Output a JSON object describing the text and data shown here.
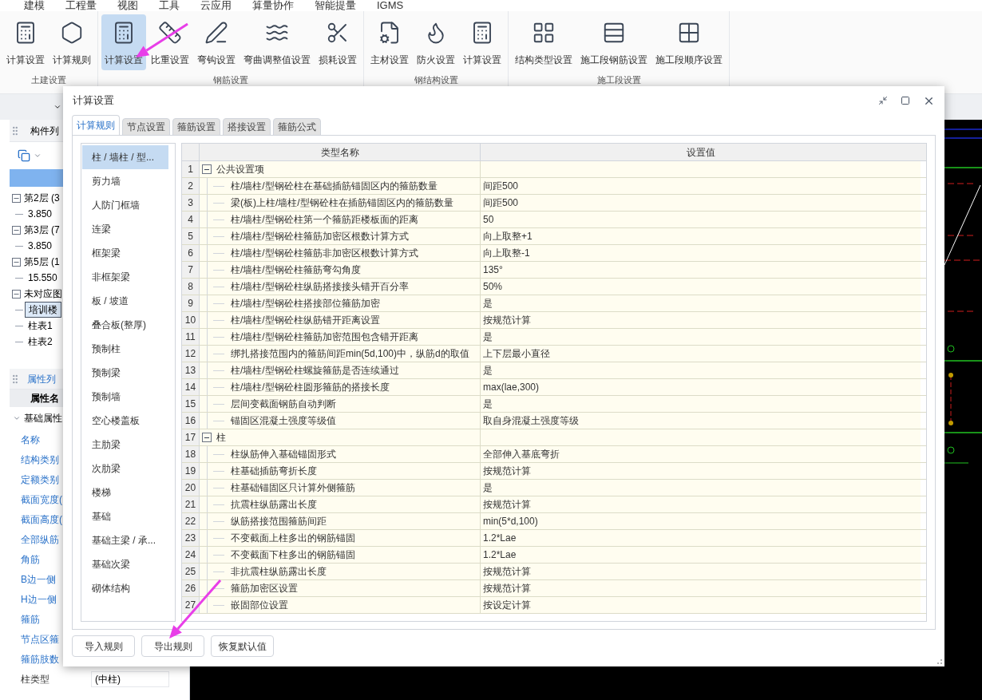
{
  "menu": [
    "建模",
    "工程量",
    "视图",
    "工具",
    "云应用",
    "算量协作",
    "智能提量",
    "IGMS"
  ],
  "ribbon": [
    {
      "group": "土建设置",
      "items": [
        {
          "label": "计算设置",
          "selected": false
        },
        {
          "label": "计算规则",
          "selected": false
        }
      ]
    },
    {
      "group": "钢筋设置",
      "items": [
        {
          "label": "计算设置",
          "selected": true
        },
        {
          "label": "比重设置",
          "selected": false
        },
        {
          "label": "弯钩设置",
          "selected": false
        },
        {
          "label": "弯曲调整值设置",
          "selected": false
        },
        {
          "label": "损耗设置",
          "selected": false
        }
      ]
    },
    {
      "group": "钢结构设置",
      "items": [
        {
          "label": "主材设置",
          "selected": false
        },
        {
          "label": "防火设置",
          "selected": false
        },
        {
          "label": "计算设置",
          "selected": false
        }
      ]
    },
    {
      "group": "施工段设置",
      "items": [
        {
          "label": "结构类型设置",
          "selected": false
        },
        {
          "label": "施工段钢筋设置",
          "selected": false
        },
        {
          "label": "施工段顺序设置",
          "selected": false
        }
      ]
    }
  ],
  "component_list": {
    "title": "构件列",
    "tree": [
      {
        "label": "第2层 (3",
        "children": [
          {
            "label": "3.850"
          }
        ]
      },
      {
        "label": "第3层 (7",
        "children": [
          {
            "label": "3.850"
          }
        ]
      },
      {
        "label": "第5层 (1",
        "children": [
          {
            "label": "15.550"
          }
        ]
      },
      {
        "label": "未对应图",
        "children": [
          {
            "label": "培训楼",
            "selected": true
          },
          {
            "label": "柱表1",
            "selected": false
          },
          {
            "label": "柱表2",
            "selected": false
          }
        ]
      }
    ]
  },
  "properties": {
    "title": "属性列",
    "column": "属性名",
    "section": "基础属性",
    "rows": [
      {
        "name": "名称",
        "public": true
      },
      {
        "name": "结构类别",
        "public": true
      },
      {
        "name": "定额类别",
        "public": true
      },
      {
        "name": "截面宽度(",
        "public": true
      },
      {
        "name": "截面高度(",
        "public": true
      },
      {
        "name": "全部纵筋",
        "public": true
      },
      {
        "name": "角筋",
        "public": true
      },
      {
        "name": "B边一侧",
        "public": true
      },
      {
        "name": "H边一侧",
        "public": true
      },
      {
        "name": "箍筋",
        "public": true
      },
      {
        "name": "节点区箍",
        "public": true
      },
      {
        "name": "箍筋肢数",
        "public": true
      },
      {
        "name": "柱类型",
        "public": false,
        "value": "(中柱)"
      }
    ]
  },
  "dialog": {
    "title": "计算设置",
    "tabs": [
      {
        "label": "计算规则",
        "selected": true
      },
      {
        "label": "节点设置",
        "selected": false
      },
      {
        "label": "箍筋设置",
        "selected": false
      },
      {
        "label": "搭接设置",
        "selected": false
      },
      {
        "label": "箍筋公式",
        "selected": false
      }
    ],
    "categories": [
      {
        "label": "柱 / 墙柱 / 型...",
        "selected": true
      },
      {
        "label": "剪力墙",
        "selected": false
      },
      {
        "label": "人防门框墙",
        "selected": false
      },
      {
        "label": "连梁",
        "selected": false
      },
      {
        "label": "框架梁",
        "selected": false
      },
      {
        "label": "非框架梁",
        "selected": false
      },
      {
        "label": "板 / 坡道",
        "selected": false
      },
      {
        "label": "叠合板(整厚)",
        "selected": false
      },
      {
        "label": "预制柱",
        "selected": false
      },
      {
        "label": "预制梁",
        "selected": false
      },
      {
        "label": "预制墙",
        "selected": false
      },
      {
        "label": "空心楼盖板",
        "selected": false
      },
      {
        "label": "主肋梁",
        "selected": false
      },
      {
        "label": "次肋梁",
        "selected": false
      },
      {
        "label": "楼梯",
        "selected": false
      },
      {
        "label": "基础",
        "selected": false
      },
      {
        "label": "基础主梁 / 承...",
        "selected": false
      },
      {
        "label": "基础次梁",
        "selected": false
      },
      {
        "label": "砌体结构",
        "selected": false
      }
    ],
    "table": {
      "columns": [
        "类型名称",
        "设置值"
      ],
      "rows": [
        {
          "no": "1",
          "kind": "group",
          "name": "公共设置项",
          "expanded": true
        },
        {
          "no": "2",
          "kind": "item",
          "name": "柱/墙柱/型钢砼柱在基础插筋锚固区内的箍筋数量",
          "value": "间距500"
        },
        {
          "no": "3",
          "kind": "item",
          "name": "梁(板)上柱/墙柱/型钢砼柱在插筋锚固区内的箍筋数量",
          "value": "间距500"
        },
        {
          "no": "4",
          "kind": "item",
          "name": "柱/墙柱/型钢砼柱第一个箍筋距楼板面的距离",
          "value": "50"
        },
        {
          "no": "5",
          "kind": "item",
          "name": "柱/墙柱/型钢砼柱箍筋加密区根数计算方式",
          "value": "向上取整+1"
        },
        {
          "no": "6",
          "kind": "item",
          "name": "柱/墙柱/型钢砼柱箍筋非加密区根数计算方式",
          "value": "向上取整-1"
        },
        {
          "no": "7",
          "kind": "item",
          "name": "柱/墙柱/型钢砼柱箍筋弯勾角度",
          "value": "135°"
        },
        {
          "no": "8",
          "kind": "item",
          "name": "柱/墙柱/型钢砼柱纵筋搭接接头错开百分率",
          "value": "50%"
        },
        {
          "no": "9",
          "kind": "item",
          "name": "柱/墙柱/型钢砼柱搭接部位箍筋加密",
          "value": "是"
        },
        {
          "no": "10",
          "kind": "item",
          "name": "柱/墙柱/型钢砼柱纵筋错开距离设置",
          "value": "按规范计算"
        },
        {
          "no": "11",
          "kind": "item",
          "name": "柱/墙柱/型钢砼柱箍筋加密范围包含错开距离",
          "value": "是"
        },
        {
          "no": "12",
          "kind": "item",
          "name": "绑扎搭接范围内的箍筋间距min(5d,100)中，纵筋d的取值",
          "value": "上下层最小直径"
        },
        {
          "no": "13",
          "kind": "item",
          "name": "柱/墙柱/型钢砼柱螺旋箍筋是否连续通过",
          "value": "是"
        },
        {
          "no": "14",
          "kind": "item",
          "name": "柱/墙柱/型钢砼柱圆形箍筋的搭接长度",
          "value": "max(lae,300)"
        },
        {
          "no": "15",
          "kind": "item",
          "name": "层间变截面钢筋自动判断",
          "value": "是"
        },
        {
          "no": "16",
          "kind": "item",
          "name": "锚固区混凝土强度等级值",
          "value": "取自身混凝土强度等级"
        },
        {
          "no": "17",
          "kind": "group",
          "name": "柱",
          "expanded": true
        },
        {
          "no": "18",
          "kind": "item",
          "name": "柱纵筋伸入基础锚固形式",
          "value": "全部伸入基底弯折"
        },
        {
          "no": "19",
          "kind": "item",
          "name": "柱基础插筋弯折长度",
          "value": "按规范计算"
        },
        {
          "no": "20",
          "kind": "item",
          "name": "柱基础锚固区只计算外侧箍筋",
          "value": "是"
        },
        {
          "no": "21",
          "kind": "item",
          "name": "抗震柱纵筋露出长度",
          "value": "按规范计算"
        },
        {
          "no": "22",
          "kind": "item",
          "name": "纵筋搭接范围箍筋间距",
          "value": "min(5*d,100)"
        },
        {
          "no": "23",
          "kind": "item",
          "name": "不变截面上柱多出的钢筋锚固",
          "value": "1.2*Lae"
        },
        {
          "no": "24",
          "kind": "item",
          "name": "不变截面下柱多出的钢筋锚固",
          "value": "1.2*Lae"
        },
        {
          "no": "25",
          "kind": "item",
          "name": "非抗震柱纵筋露出长度",
          "value": "按规范计算"
        },
        {
          "no": "26",
          "kind": "item",
          "name": "箍筋加密区设置",
          "value": "按规范计算"
        },
        {
          "no": "27",
          "kind": "item",
          "name": "嵌固部位设置",
          "value": "按设定计算"
        }
      ]
    },
    "buttons": [
      "导入规则",
      "导出规则",
      "恢复默认值"
    ]
  }
}
